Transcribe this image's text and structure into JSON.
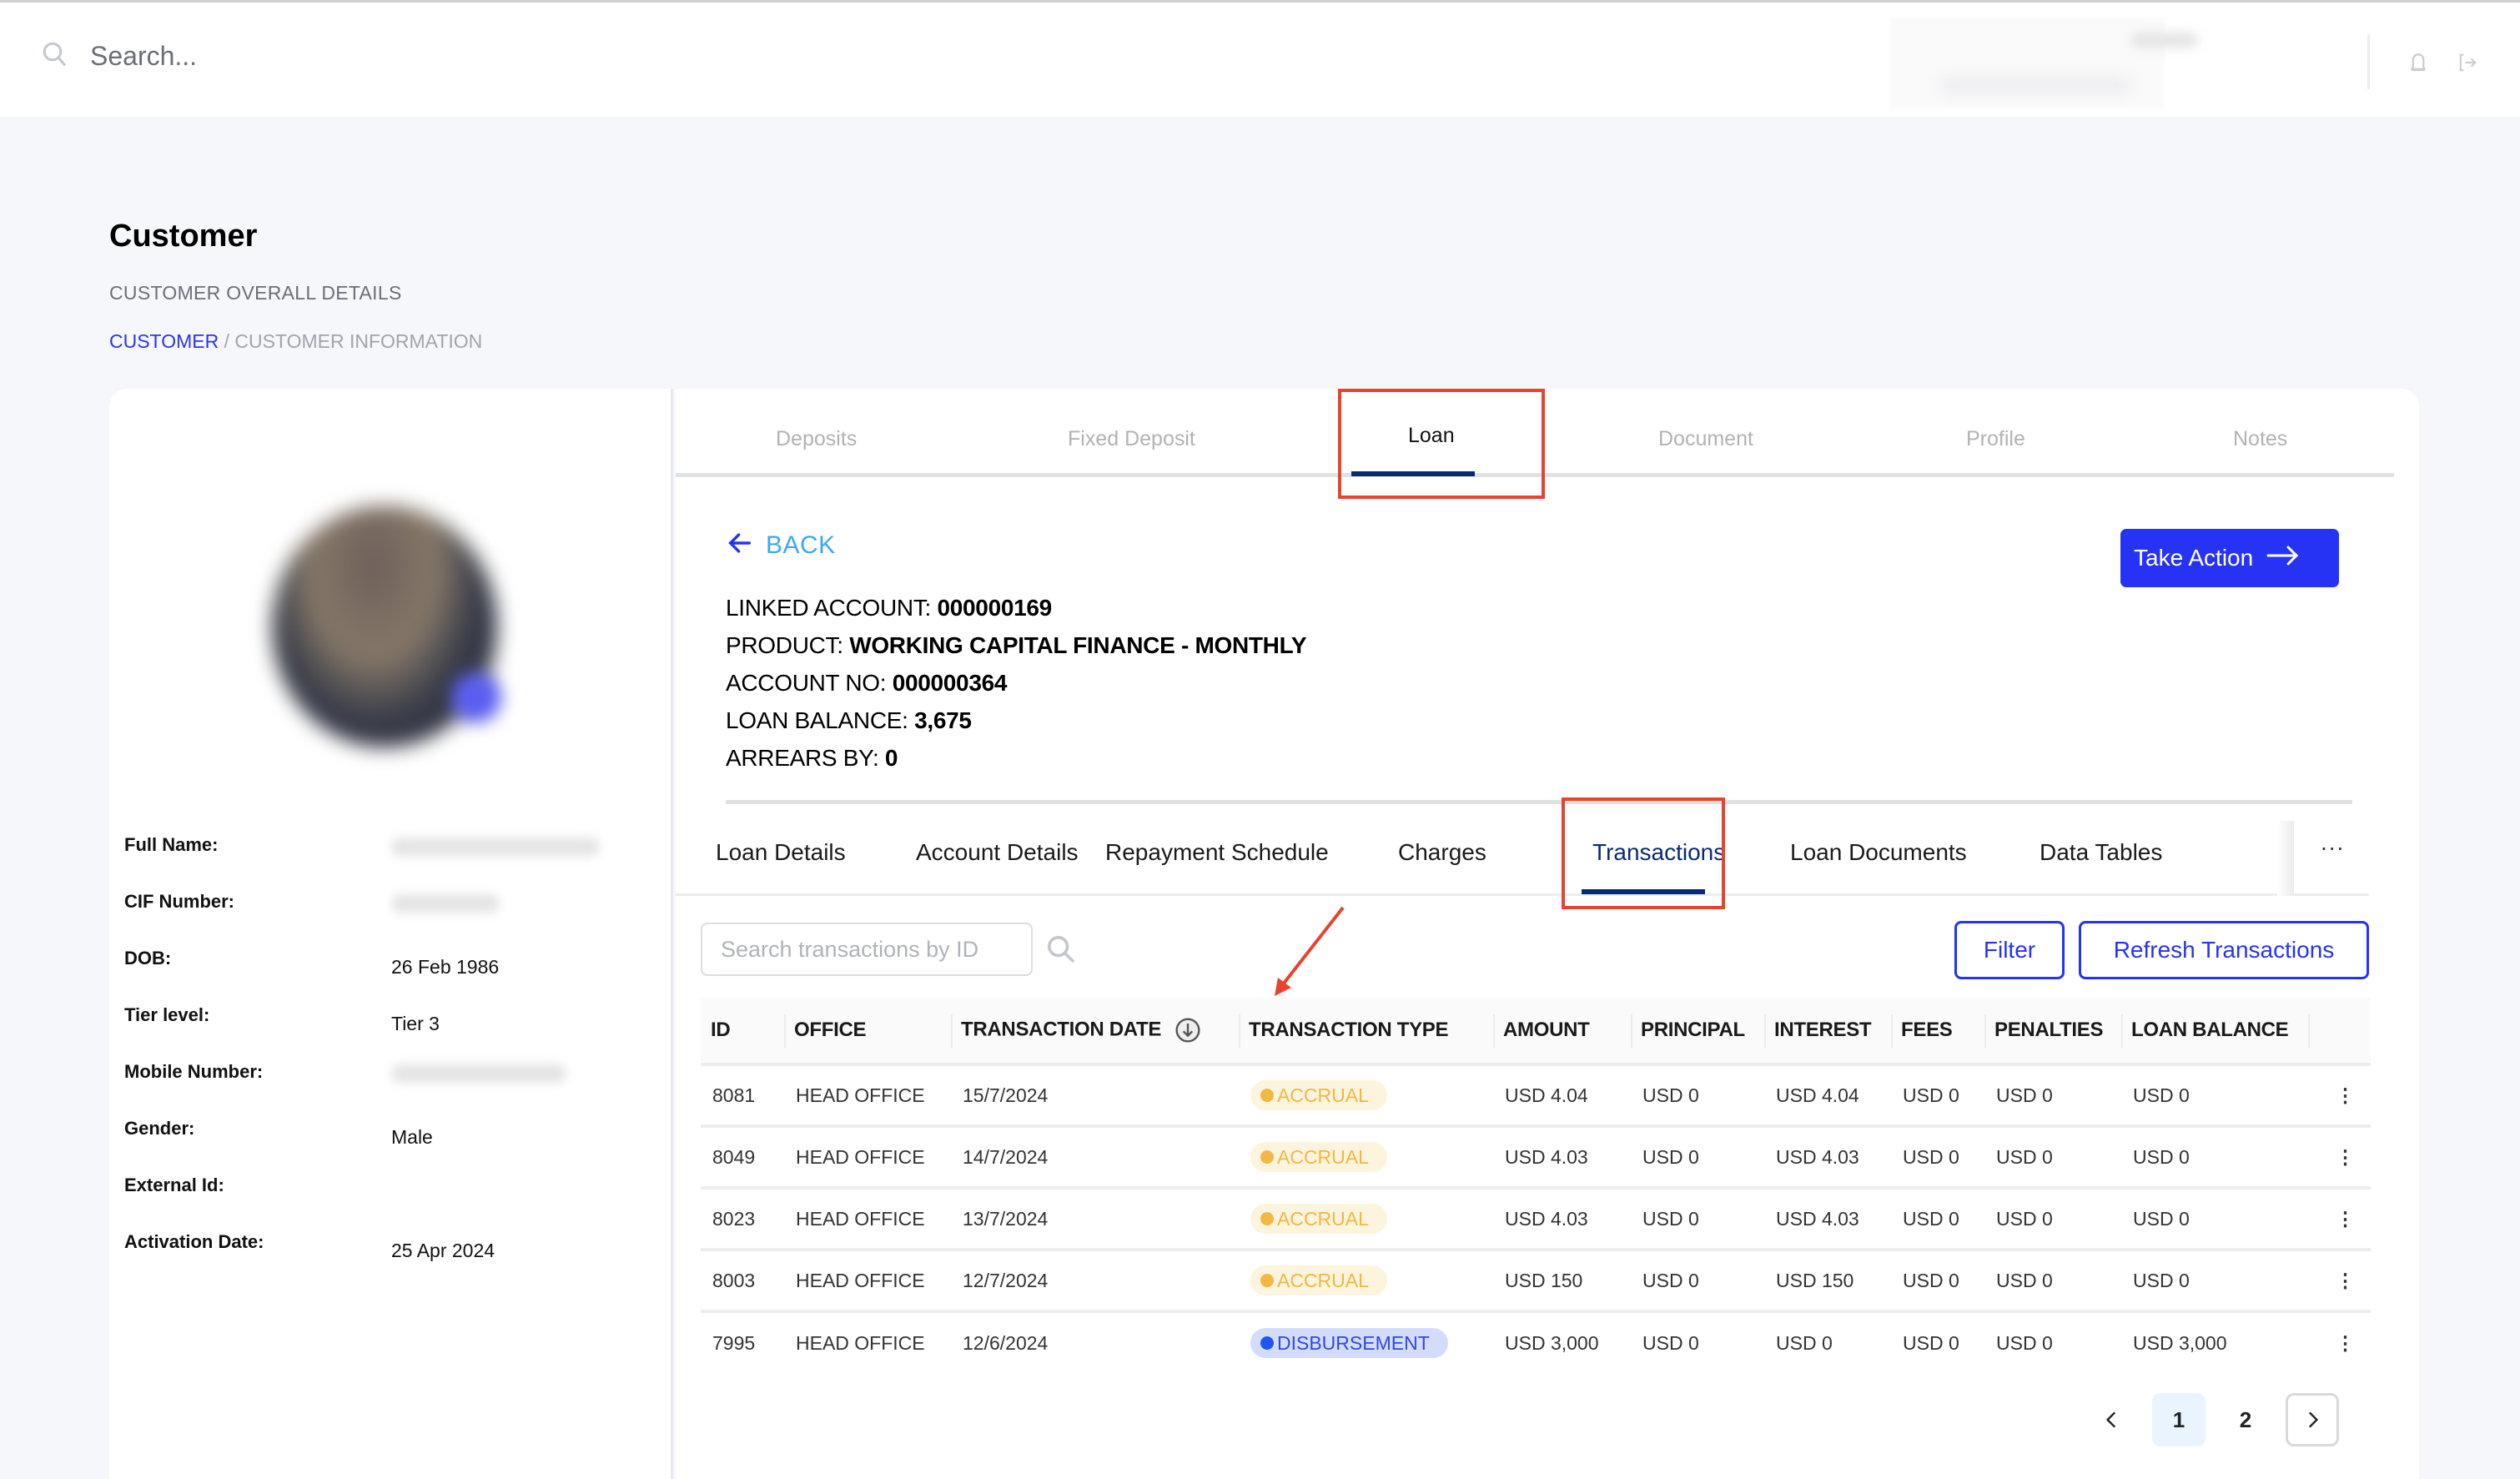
{
  "topbar": {
    "search_placeholder": "Search...",
    "icons": [
      "search-icon",
      "bell-icon",
      "logout-icon"
    ]
  },
  "header": {
    "title": "Customer",
    "subtitle": "CUSTOMER OVERALL DETAILS",
    "breadcrumb": {
      "link": "CUSTOMER",
      "separator": " / ",
      "current": "CUSTOMER INFORMATION"
    }
  },
  "profile": {
    "fields": [
      {
        "label": "Full Name:",
        "value": "",
        "redacted": true
      },
      {
        "label": "CIF Number:",
        "value": "",
        "redacted": true
      },
      {
        "label": "DOB:",
        "value": "26 Feb 1986"
      },
      {
        "label": "Tier level:",
        "value": "Tier 3"
      },
      {
        "label": "Mobile Number:",
        "value": "",
        "redacted": true
      },
      {
        "label": "Gender:",
        "value": "Male"
      },
      {
        "label": "External Id:",
        "value": ""
      },
      {
        "label": "Activation Date:",
        "value": "25 Apr 2024"
      }
    ]
  },
  "main_tabs": [
    {
      "label": "Deposits",
      "active": false
    },
    {
      "label": "Fixed Deposit",
      "active": false
    },
    {
      "label": "Loan",
      "active": true
    },
    {
      "label": "Document",
      "active": false
    },
    {
      "label": "Profile",
      "active": false
    },
    {
      "label": "Notes",
      "active": false
    }
  ],
  "loan": {
    "back_label": "BACK",
    "take_action_label": "Take Action",
    "info": [
      {
        "label": "LINKED ACCOUNT: ",
        "value": "000000169"
      },
      {
        "label": "PRODUCT: ",
        "value": "WORKING CAPITAL FINANCE - MONTHLY"
      },
      {
        "label": "ACCOUNT NO: ",
        "value": "000000364"
      },
      {
        "label": "LOAN BALANCE: ",
        "value": "3,675"
      },
      {
        "label": "ARREARS BY: ",
        "value": "0"
      }
    ]
  },
  "sub_tabs": [
    {
      "label": "Loan Details",
      "active": false
    },
    {
      "label": "Account Details",
      "active": false
    },
    {
      "label": "Repayment Schedule",
      "active": false
    },
    {
      "label": "Charges",
      "active": false
    },
    {
      "label": "Transactions",
      "active": true
    },
    {
      "label": "Loan Documents",
      "active": false
    },
    {
      "label": "Data Tables",
      "active": false
    }
  ],
  "sub_tabs_more": "...",
  "transactions": {
    "search_placeholder": "Search transactions by ID",
    "filter_label": "Filter",
    "refresh_label": "Refresh Transactions",
    "sort_column": "TRANSACTION DATE",
    "sort_direction": "descending",
    "columns": [
      "ID",
      "OFFICE",
      "TRANSACTION DATE",
      "TRANSACTION TYPE",
      "AMOUNT",
      "PRINCIPAL",
      "INTEREST",
      "FEES",
      "PENALTIES",
      "LOAN BALANCE"
    ],
    "rows": [
      {
        "id": "8081",
        "office": "HEAD OFFICE",
        "date": "15/7/2024",
        "type": "ACCRUAL",
        "amount": "USD 4.04",
        "principal": "USD 0",
        "interest": "USD 4.04",
        "fees": "USD 0",
        "penalties": "USD 0",
        "balance": "USD 0"
      },
      {
        "id": "8049",
        "office": "HEAD OFFICE",
        "date": "14/7/2024",
        "type": "ACCRUAL",
        "amount": "USD 4.03",
        "principal": "USD 0",
        "interest": "USD 4.03",
        "fees": "USD 0",
        "penalties": "USD 0",
        "balance": "USD 0"
      },
      {
        "id": "8023",
        "office": "HEAD OFFICE",
        "date": "13/7/2024",
        "type": "ACCRUAL",
        "amount": "USD 4.03",
        "principal": "USD 0",
        "interest": "USD 4.03",
        "fees": "USD 0",
        "penalties": "USD 0",
        "balance": "USD 0"
      },
      {
        "id": "8003",
        "office": "HEAD OFFICE",
        "date": "12/7/2024",
        "type": "ACCRUAL",
        "amount": "USD 150",
        "principal": "USD 0",
        "interest": "USD 150",
        "fees": "USD 0",
        "penalties": "USD 0",
        "balance": "USD 0"
      },
      {
        "id": "7995",
        "office": "HEAD OFFICE",
        "date": "12/6/2024",
        "type": "DISBURSEMENT",
        "amount": "USD 3,000",
        "principal": "USD 0",
        "interest": "USD 0",
        "fees": "USD 0",
        "penalties": "USD 0",
        "balance": "USD 3,000"
      }
    ]
  },
  "pagination": {
    "pages": [
      "1",
      "2"
    ],
    "current": "1"
  },
  "colors": {
    "primary": "#2633f5",
    "active_tab": "#0b2a6e",
    "accrual": "#f1b843",
    "disbursement": "#2155f0",
    "annotation": "#e8432e",
    "back_link": "#3ba8f5"
  }
}
